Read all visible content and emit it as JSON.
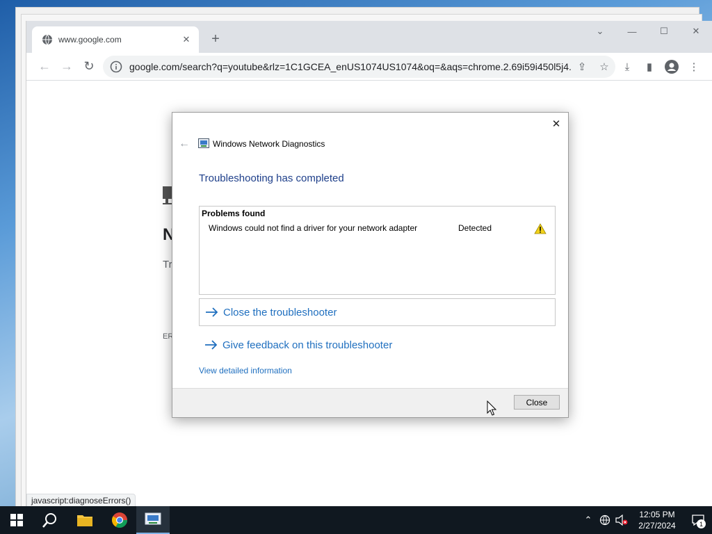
{
  "browser": {
    "tab_title": "www.google.com",
    "url": "google.com/search?q=youtube&rlz=1C1GCEA_enUS1074US1074&oq=&aqs=chrome.2.69i59i450l5j4...",
    "status_text": "javascript:diagnoseErrors()"
  },
  "page": {
    "error_heading": "N",
    "error_try": "Try",
    "error_code": "ERI"
  },
  "dialog": {
    "title": "Windows Network Diagnostics",
    "heading": "Troubleshooting has completed",
    "problems_title": "Problems found",
    "problems": [
      {
        "description": "Windows could not find a driver for your network adapter",
        "status": "Detected",
        "icon": "warning-icon"
      }
    ],
    "actions": [
      {
        "label": "Close the troubleshooter"
      },
      {
        "label": "Give feedback on this troubleshooter"
      }
    ],
    "details_link": "View detailed information",
    "close_button": "Close"
  },
  "taskbar": {
    "time": "12:05 PM",
    "date": "2/27/2024",
    "notification_count": "1"
  },
  "colors": {
    "heading_blue": "#1e3f8a",
    "link_blue": "#1f6fbf",
    "taskbar": "#101820"
  }
}
